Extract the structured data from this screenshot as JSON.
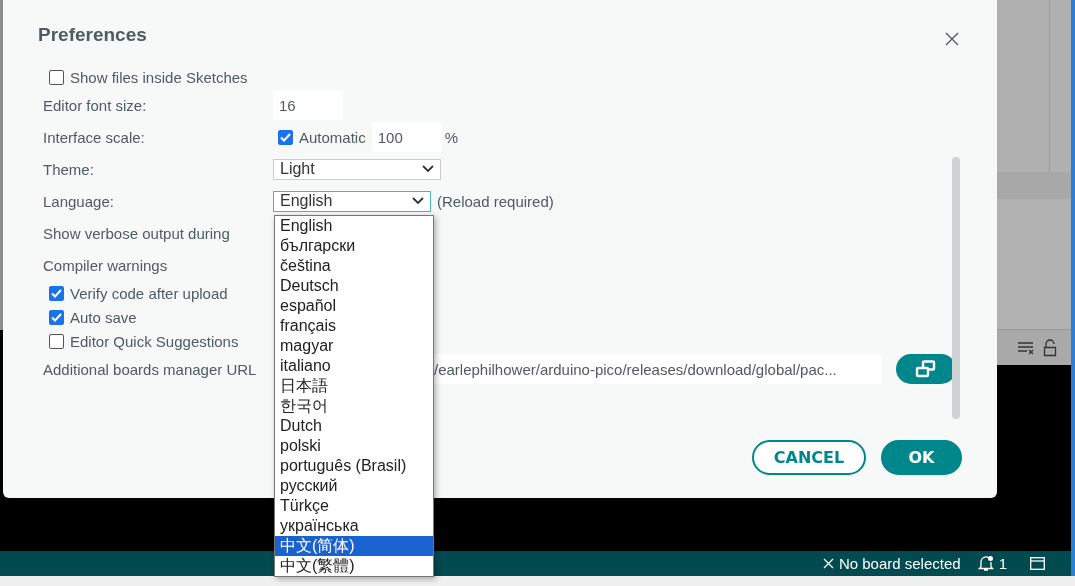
{
  "dialog": {
    "title": "Preferences",
    "settings": [
      {
        "kind": "checkbox",
        "label": "Show files inside Sketches",
        "checked": false
      },
      {
        "kind": "number",
        "label": "Editor font size:",
        "value": "16"
      },
      {
        "kind": "scale",
        "label": "Interface scale:",
        "checked": true,
        "checkbox_label": "Automatic",
        "value": "100",
        "unit": "%"
      },
      {
        "kind": "select",
        "label": "Theme:",
        "value": "Light",
        "focused": false
      },
      {
        "kind": "select",
        "label": "Language:",
        "value": "English",
        "focused": true,
        "note": "(Reload required)"
      },
      {
        "kind": "text",
        "label": "Show verbose output during"
      },
      {
        "kind": "text",
        "label": "Compiler warnings"
      },
      {
        "kind": "checkbox",
        "label": "Verify code after upload",
        "checked": true
      },
      {
        "kind": "checkbox",
        "label": "Auto save",
        "checked": true
      },
      {
        "kind": "checkbox",
        "label": "Editor Quick Suggestions",
        "checked": false
      },
      {
        "kind": "url",
        "label": "Additional boards manager URL",
        "value": "/earlephilhower/arduino-pico/releases/download/global/pac..."
      }
    ],
    "buttons": [
      {
        "label": "CANCEL",
        "kind": "secondary"
      },
      {
        "label": "OK",
        "kind": "primary"
      }
    ]
  },
  "dropdown": {
    "options": [
      {
        "label": "English",
        "selected": false
      },
      {
        "label": "български",
        "selected": false
      },
      {
        "label": "čeština",
        "selected": false
      },
      {
        "label": "Deutsch",
        "selected": false
      },
      {
        "label": "español",
        "selected": false
      },
      {
        "label": "français",
        "selected": false
      },
      {
        "label": "magyar",
        "selected": false
      },
      {
        "label": "italiano",
        "selected": false
      },
      {
        "label": "日本語",
        "selected": false
      },
      {
        "label": "한국어",
        "selected": false
      },
      {
        "label": "Dutch",
        "selected": false
      },
      {
        "label": "polski",
        "selected": false
      },
      {
        "label": "português (Brasil)",
        "selected": false
      },
      {
        "label": "русский",
        "selected": false
      },
      {
        "label": "Türkçe",
        "selected": false
      },
      {
        "label": "українська",
        "selected": false
      },
      {
        "label": "中文(简体)",
        "selected": true
      },
      {
        "label": "中文(繁體)",
        "selected": false
      }
    ]
  },
  "status_bar": {
    "board": "No board selected",
    "notifications": "1"
  }
}
